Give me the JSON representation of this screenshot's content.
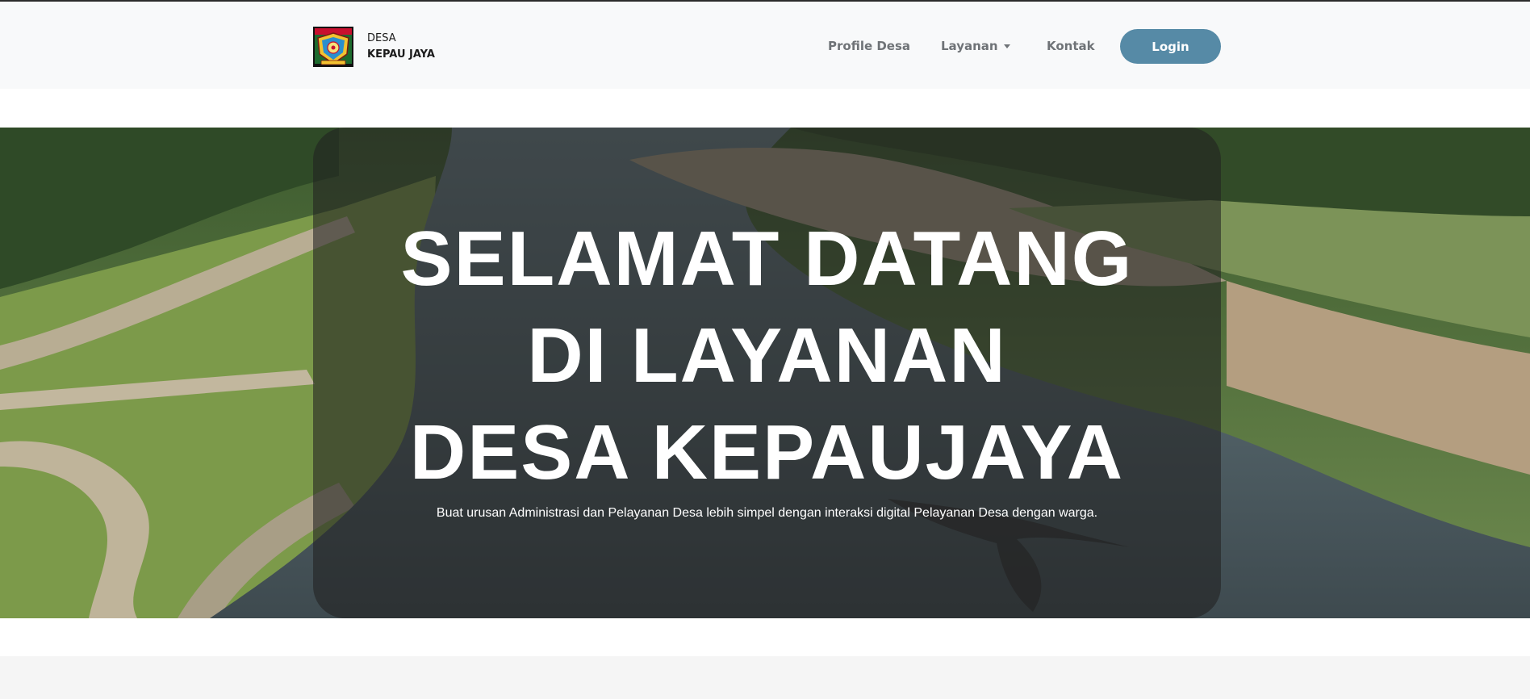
{
  "brand": {
    "line1": "DESA",
    "line2": "KEPAU JAYA",
    "logo_icon": "village-emblem-icon"
  },
  "nav": {
    "items": [
      {
        "label": "Profile Desa"
      },
      {
        "label": "Layanan",
        "has_dropdown": true
      },
      {
        "label": "Kontak"
      }
    ],
    "login_label": "Login"
  },
  "hero": {
    "title_lines": [
      "SELAMAT DATANG",
      "DI LAYANAN",
      "DESA KEPAUJAYA"
    ],
    "subtitle": "Buat urusan Administrasi dan Pelayanan Desa lebih simpel dengan interaksi digital Pelayanan Desa dengan warga.",
    "background_icon": "river-aerial-photo"
  },
  "colors": {
    "navbar_bg": "#f8f9fa",
    "login_button": "#568aa6",
    "nav_text": "#6f7377",
    "overlay": "#202020"
  }
}
